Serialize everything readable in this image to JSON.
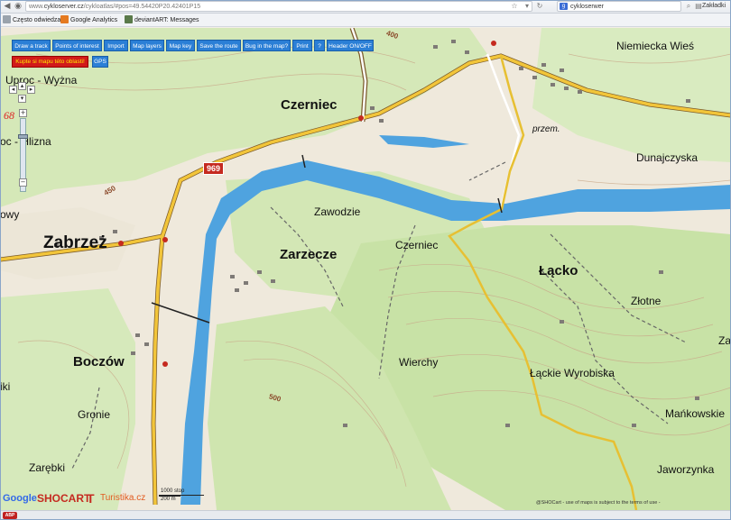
{
  "browser": {
    "url_prefix": "www.",
    "url_domain": "cykloserver.cz",
    "url_rest": "/cykloatlas/#pos=49.54420P20.42401P15",
    "search_query": "cykloserwer",
    "bookmarks_menu": "Zakładki",
    "bookmarks": [
      {
        "label": "Często odwiedzane",
        "color": "#9aa3ad"
      },
      {
        "label": "Google Analytics",
        "color": "#e57a1f"
      },
      {
        "label": "deviantART: Messages",
        "color": "#5a7a4a"
      }
    ]
  },
  "toolbar": {
    "buttons": [
      "Draw a track",
      "Points of interest",
      "Import",
      "Map layers",
      "Map key",
      "Save the route",
      "Bug in the map?",
      "Print",
      "?",
      "Header ON/OFF"
    ],
    "buy_button": "Kupte si mapu této oblasti!",
    "gps_button": "GPS"
  },
  "zoom": {
    "level": "68",
    "plus": "+",
    "minus": "−"
  },
  "map": {
    "places": {
      "czerniec_top": "Czerniec",
      "niemiecka_wies": "Niemiecka Wieś",
      "dunajczyska": "Dunajczyska",
      "zawodzie": "Zawodzie",
      "zabrzez": "Zabrzeż",
      "zarzecze": "Zarzecze",
      "czerniec_mid": "Czerniec",
      "lacko": "Łącko",
      "zlotne": "Złotne",
      "boczow": "Boczów",
      "wierchy": "Wierchy",
      "lackie_wyrobiska": "Łąckie Wyrobiska",
      "gronie": "Gronie",
      "mankowskie": "Mańkowskie",
      "zarebki": "Zarębki",
      "jaworzynka": "Jaworzynka",
      "przem": "przem.",
      "uproc": "Uproc - Wyżna",
      "olszyna": "oc - Hlizna",
      "owy": "owy",
      "iki": "iki",
      "za": "Za"
    },
    "contours": [
      "400",
      "450",
      "500"
    ],
    "road_number": "969"
  },
  "scale": {
    "top": "1000 stop",
    "bottom": "200 m"
  },
  "logos": {
    "google": "Google",
    "shocart_a": "SHO",
    "shocart_b": "CART",
    "t_logo": "T",
    "turistika": "Turistika.cz"
  },
  "attribution": "@SHOCart - use of maps is subject to the terms of use - ",
  "colors": {
    "river": "#4fa3df",
    "forest": "#c9e2a8",
    "road_main": "#f2c53a",
    "route": "#e7c033",
    "button": "#2b7fd6"
  }
}
